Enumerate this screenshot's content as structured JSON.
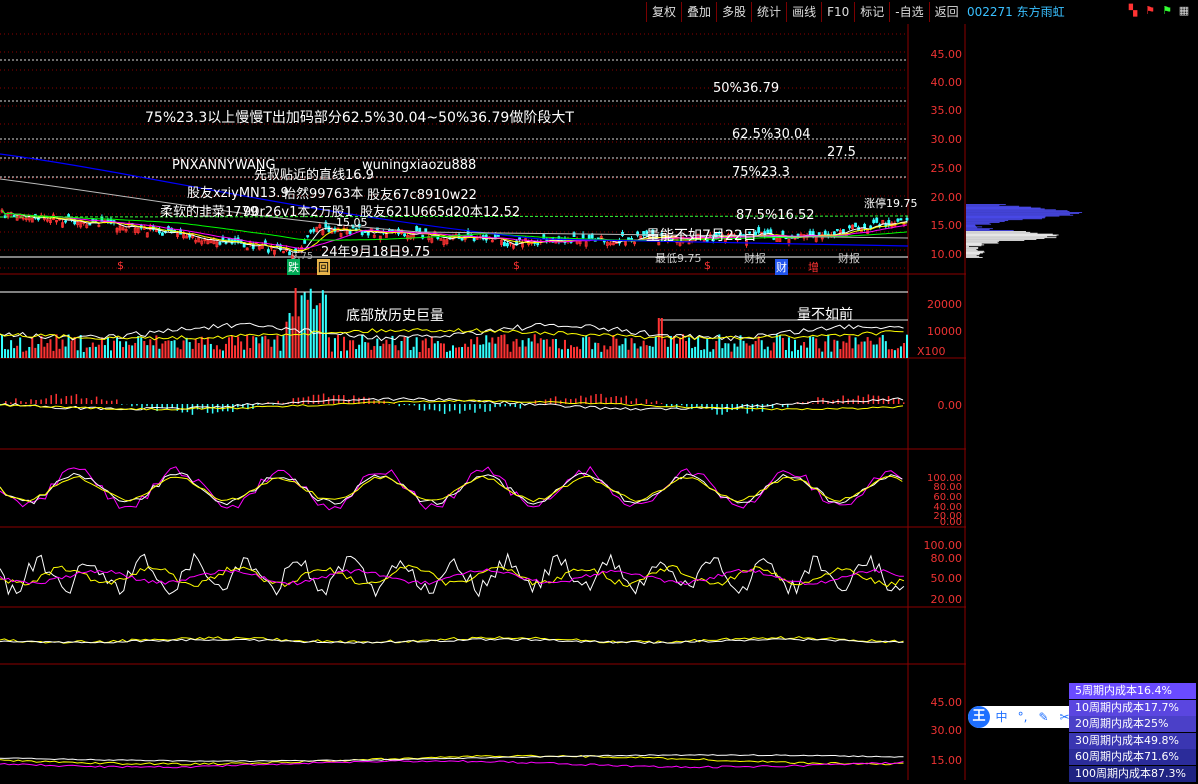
{
  "toolbar": {
    "buttons": [
      "复权",
      "叠加",
      "多股",
      "统计",
      "画线",
      "F10",
      "标记",
      "-自选",
      "返回"
    ],
    "stock": "002271 东方雨虹"
  },
  "colors": {
    "up": "#ff3333",
    "down": "#33ffff",
    "ma5": "#ffffff",
    "ma10": "#ffff00",
    "ma20": "#ff00ff",
    "ma60": "#00ff00",
    "accent_line": "#0000ff",
    "grid": "#8b0000"
  },
  "main_panel": {
    "price_ticks": [
      "45.00",
      "40.00",
      "35.00",
      "30.00",
      "25.00",
      "20.00",
      "15.00",
      "10.00"
    ],
    "annotations": {
      "plan": "75%23.3以上慢慢T出加码部分62.5%30.04~50%36.79做阶段大T",
      "level_50": "50%36.79",
      "level_625": "62.5%30.04",
      "level_275": "27.5",
      "level_75": "75%23.3",
      "level_875": "87.5%16.52",
      "limit_up": "涨停19.75",
      "user1": "PNXANNYWANG",
      "user1b": "先叔贴近的直线16.9",
      "user2": "wuningxiaozu888",
      "user3": "股友xziyMN13.9",
      "user3b": "怡然99763本",
      "user3c": "股友67c8910w22",
      "user4": "柔软的韭菜1779",
      "user4b": "90r26v1本2万股1",
      "user4c": "股友621U665d20本12.52",
      "price_mid": "15.05",
      "low_date": "24年9月18日9.75",
      "vol_note_main": "量能不如7月22日",
      "low_price": "9.75",
      "bottom_text1": "最低9.75",
      "bottom_text2": "财报",
      "bottom_text3": "财报"
    },
    "markers": [
      "$",
      "跌",
      "回",
      "$",
      "$",
      "财",
      "增"
    ]
  },
  "volume_panel": {
    "ticks": [
      "20000",
      "10000"
    ],
    "unit": "X100",
    "note1": "底部放历史巨量",
    "note2": "量不如前"
  },
  "macd_panel": {
    "ticks": [
      "0.00"
    ]
  },
  "kdj_panel": {
    "ticks": [
      "100.00",
      "80.00",
      "60.00",
      "40.00",
      "20.00",
      "0.00"
    ]
  },
  "rsi_panel": {
    "ticks": [
      "100.00",
      "80.00",
      "50.00",
      "20.00"
    ]
  },
  "bottom_panel": {
    "ticks": [
      "45.00",
      "30.00",
      "15.00"
    ]
  },
  "ime": {
    "logo": "王",
    "items": [
      "中",
      "°,",
      "✎",
      "✂",
      "⌨",
      "👕",
      "⚙"
    ]
  },
  "cost_panel": [
    {
      "label": "5周期内成本16.4%",
      "color": "#6a4bff"
    },
    {
      "label": "10周期内成本17.7%",
      "color": "#5a46e0"
    },
    {
      "label": "20周期内成本25%",
      "color": "#4b40c8"
    },
    {
      "label": "30周期内成本49.8%",
      "color": "#3a36b2"
    },
    {
      "label": "60周期内成本71.6%",
      "color": "#2b2c9a"
    },
    {
      "label": "100周期内成本87.3%",
      "color": "#1f2382"
    }
  ]
}
